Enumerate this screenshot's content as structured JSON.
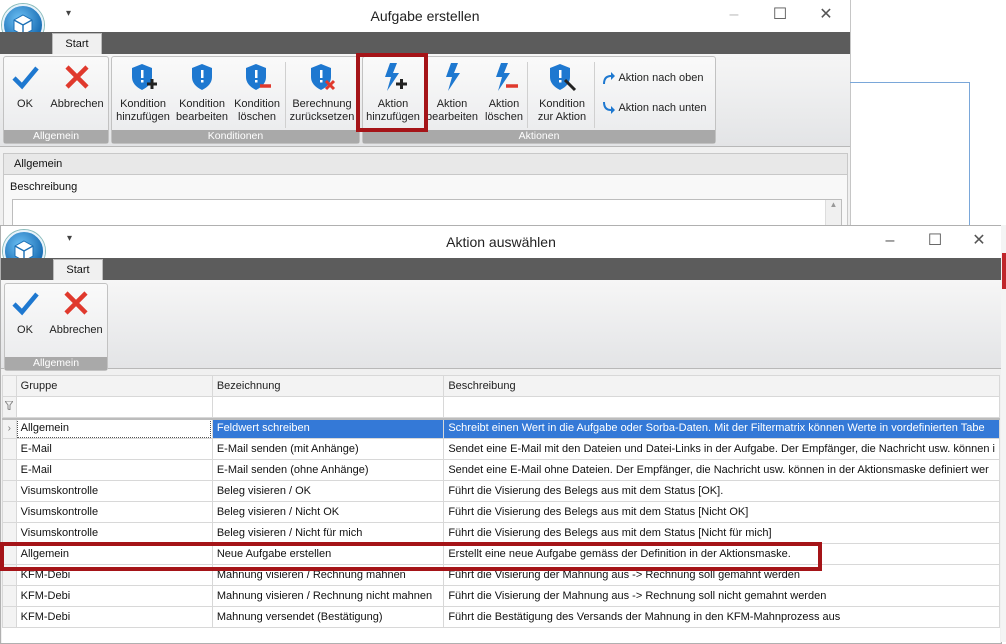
{
  "bg_window": {
    "title": "Aufgabe erstellen",
    "qat_glyph": "▾",
    "tab": "Start",
    "groups": [
      {
        "label": "Allgemein",
        "buttons": [
          {
            "label": "OK",
            "icon": "check-icon"
          },
          {
            "label": "Abbrechen",
            "icon": "x-icon"
          }
        ]
      },
      {
        "label": "Konditionen",
        "buttons": [
          {
            "label": "Kondition hinzufügen",
            "icon": "shield-add-icon"
          },
          {
            "label": "Kondition bearbeiten",
            "icon": "shield-edit-icon"
          },
          {
            "label": "Kondition löschen",
            "icon": "shield-delete-icon"
          },
          {
            "label": "Berechnung zurücksetzen",
            "icon": "shield-reset-icon"
          }
        ]
      },
      {
        "label": "Aktionen",
        "buttons": [
          {
            "label": "Aktion hinzufügen",
            "icon": "bolt-add-icon"
          },
          {
            "label": "Aktion bearbeiten",
            "icon": "bolt-edit-icon"
          },
          {
            "label": "Aktion löschen",
            "icon": "bolt-delete-icon"
          },
          {
            "label": "Kondition zur Aktion",
            "icon": "shield-bolt-icon"
          },
          {
            "label": "Aktion nach oben",
            "icon": "arrow-up-icon"
          },
          {
            "label": "Aktion nach unten",
            "icon": "arrow-down-icon"
          }
        ]
      }
    ],
    "section_header": "Allgemein",
    "field_label": "Beschreibung"
  },
  "fg_window": {
    "title": "Aktion auswählen",
    "qat_glyph": "▾",
    "tab": "Start",
    "group": {
      "label": "Allgemein",
      "ok_label": "OK",
      "cancel_label": "Abbrechen"
    },
    "columns": [
      "Gruppe",
      "Bezeichnung",
      "Beschreibung"
    ],
    "rows": [
      {
        "gruppe": "Allgemein",
        "bezeichnung": "Feldwert schreiben",
        "beschreibung": "Schreibt einen Wert in die Aufgabe oder Sorba-Daten. Mit der Filtermatrix können Werte in vordefinierten Tabe",
        "selected": true
      },
      {
        "gruppe": "E-Mail",
        "bezeichnung": "E-Mail senden (mit Anhänge)",
        "beschreibung": "Sendet eine E-Mail mit den Dateien und Datei-Links in der Aufgabe. Der Empfänger, die Nachricht usw. können i"
      },
      {
        "gruppe": "E-Mail",
        "bezeichnung": "E-Mail senden (ohne Anhänge)",
        "beschreibung": "Sendet eine E-Mail ohne Dateien. Der Empfänger, die Nachricht usw. können in der Aktionsmaske definiert wer"
      },
      {
        "gruppe": "Visumskontrolle",
        "bezeichnung": "Beleg visieren / OK",
        "beschreibung": "Führt die Visierung des Belegs aus mit dem Status [OK]."
      },
      {
        "gruppe": "Visumskontrolle",
        "bezeichnung": "Beleg visieren / Nicht OK",
        "beschreibung": "Führt die Visierung des Belegs aus mit dem Status [Nicht OK]"
      },
      {
        "gruppe": "Visumskontrolle",
        "bezeichnung": "Beleg visieren / Nicht für mich",
        "beschreibung": "Führt die Visierung des Belegs aus mit dem Status [Nicht für mich]"
      },
      {
        "gruppe": "Allgemein",
        "bezeichnung": "Neue Aufgabe erstellen",
        "beschreibung": "Erstellt eine neue Aufgabe gemäss der Definition in der Aktionsmaske.",
        "highlighted": true
      },
      {
        "gruppe": "KFM-Debi",
        "bezeichnung": "Mahnung visieren / Rechnung mahnen",
        "beschreibung": "Führt die Visierung der Mahnung aus -> Rechnung soll gemahnt werden"
      },
      {
        "gruppe": "KFM-Debi",
        "bezeichnung": "Mahnung visieren / Rechnung nicht mahnen",
        "beschreibung": "Führt die Visierung der Mahnung aus -> Rechnung soll nicht gemahnt werden"
      },
      {
        "gruppe": "KFM-Debi",
        "bezeichnung": "Mahnung versendet (Bestätigung)",
        "beschreibung": "Führt die Bestätigung des Versands der Mahnung in den KFM-Mahnprozess aus"
      }
    ]
  },
  "colors": {
    "selection": "#3479d7",
    "highlight_box": "#a51418",
    "icon_blue": "#1e78d0",
    "icon_red": "#e0392d",
    "tabstrip": "#5c5c5c",
    "group_label": "#a9a9a9"
  }
}
